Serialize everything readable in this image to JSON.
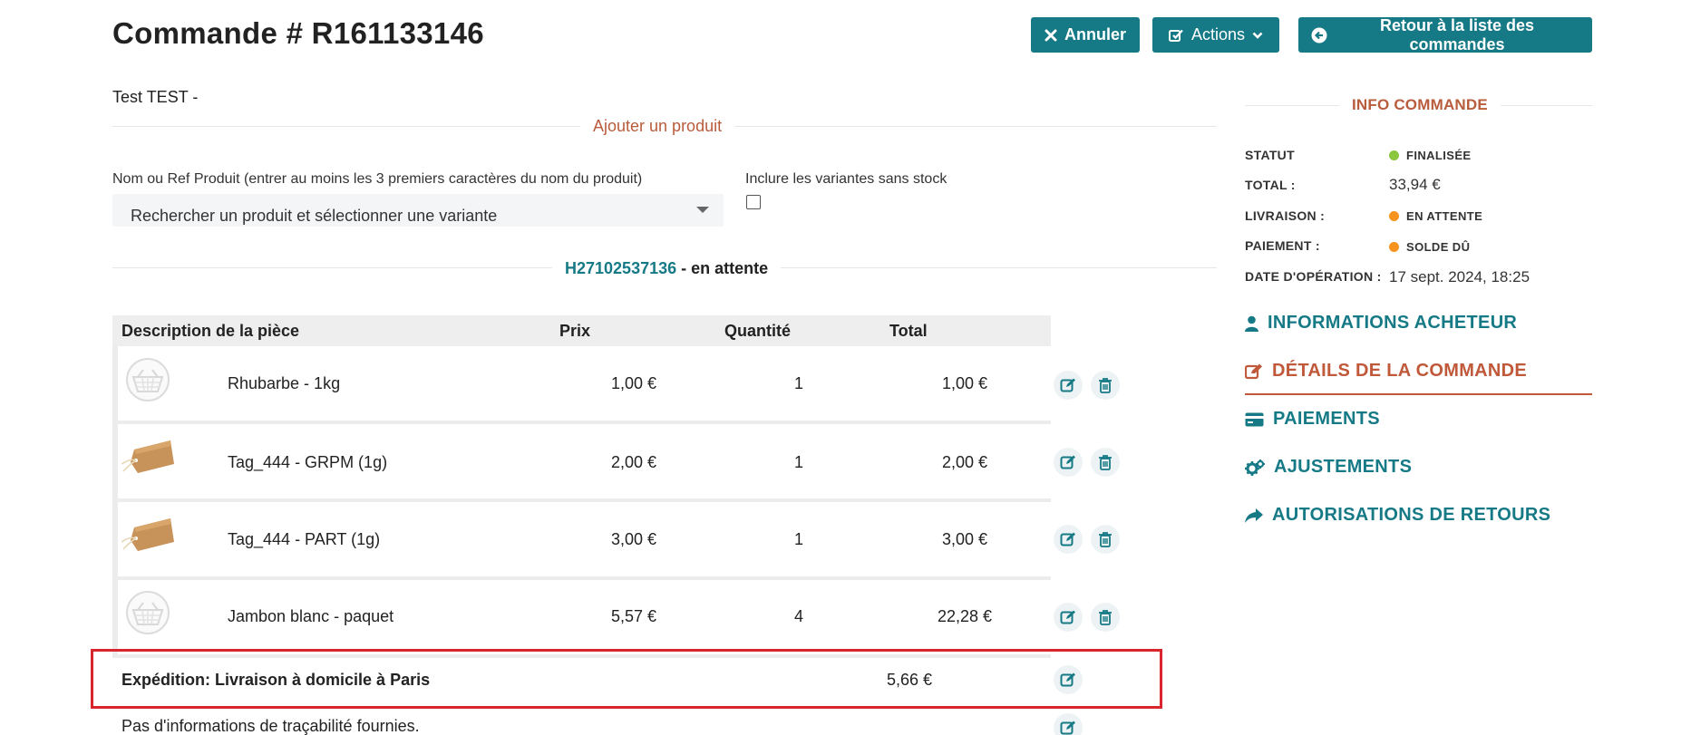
{
  "header": {
    "title": "Commande # R161133146",
    "cancel_label": "Annuler",
    "actions_label": "Actions",
    "back_label": "Retour à la liste des commandes"
  },
  "customer": "Test TEST -",
  "add_product": {
    "section_title": "Ajouter un produit",
    "search_label": "Nom ou Ref Produit (entrer au moins les 3 premiers caractères du nom du produit)",
    "search_placeholder": "Rechercher un produit et sélectionner une variante",
    "include_label": "Inclure les variantes sans stock",
    "include_checked": false
  },
  "shipment": {
    "id": "H27102537136",
    "status": "- en attente"
  },
  "table": {
    "headers": {
      "description": "Description de la pièce",
      "price": "Prix",
      "quantity": "Quantité",
      "total": "Total"
    },
    "rows": [
      {
        "name": "Rhubarbe - 1kg",
        "price": "1,00 €",
        "quantity": "1",
        "total": "1,00 €",
        "image": "basket-placeholder-icon"
      },
      {
        "name": "Tag_444 - GRPM (1g)",
        "price": "2,00 €",
        "quantity": "1",
        "total": "2,00 €",
        "image": "kraft-tag-image"
      },
      {
        "name": "Tag_444 - PART (1g)",
        "price": "3,00 €",
        "quantity": "1",
        "total": "3,00 €",
        "image": "kraft-tag-image"
      },
      {
        "name": "Jambon blanc - paquet",
        "price": "5,57 €",
        "quantity": "4",
        "total": "22,28 €",
        "image": "basket-placeholder-icon"
      }
    ],
    "shipping": {
      "label": "Expédition: Livraison à domicile à Paris",
      "amount": "5,66 €"
    },
    "tracking": "Pas d'informations de traçabilité fournies."
  },
  "info": {
    "title": "INFO COMMANDE",
    "status_label": "STATUT",
    "status_value": "FINALISÉE",
    "status_color": "#8cc63f",
    "total_label": "TOTAL :",
    "total_value": "33,94 €",
    "delivery_label": "LIVRAISON :",
    "delivery_value": "EN ATTENTE",
    "delivery_color": "#f7941d",
    "payment_label": "PAIEMENT :",
    "payment_value": "SOLDE DÛ",
    "payment_color": "#f7941d",
    "date_label": "DATE D'OPÉRATION :",
    "date_value": "17 sept. 2024, 18:25"
  },
  "nav": {
    "buyer": "INFORMATIONS ACHETEUR",
    "details": "DÉTAILS DE LA COMMANDE",
    "payments": "PAIEMENTS",
    "adjustments": "AJUSTEMENTS",
    "returns": "AUTORISATIONS DE RETOURS"
  },
  "colors": {
    "accent": "#167a86",
    "active": "#c0583a",
    "highlight": "#d9262e"
  }
}
